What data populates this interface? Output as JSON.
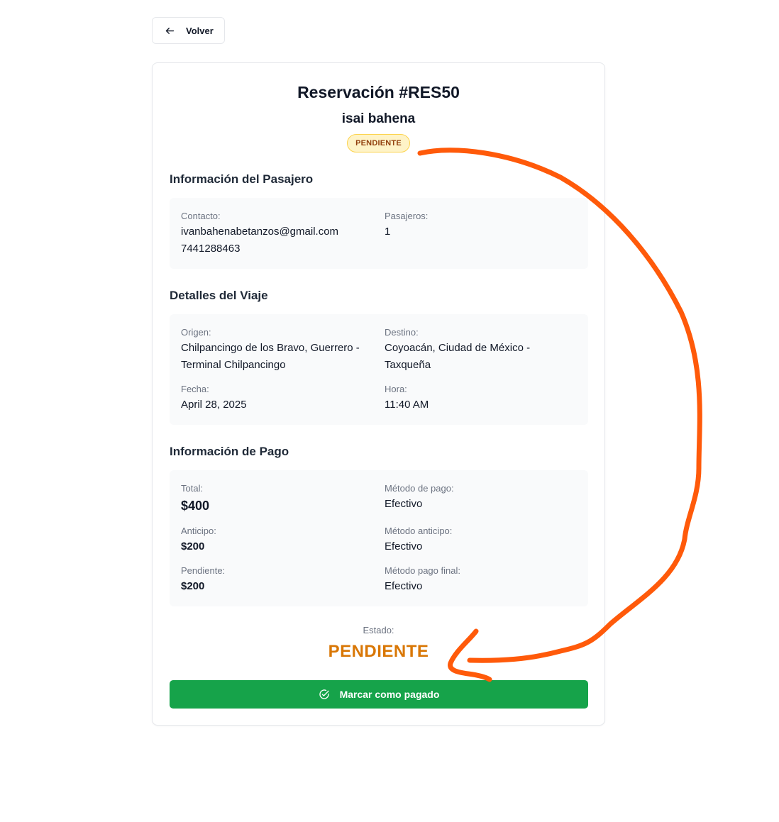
{
  "back_button": {
    "label": "Volver",
    "icon": "arrow-left-icon"
  },
  "reservation": {
    "title": "Reservación #RES50",
    "customer_name": "isai bahena",
    "status_badge": "PENDIENTE"
  },
  "passenger": {
    "section_title": "Información del Pasajero",
    "contact_label": "Contacto:",
    "email": "ivanbahenabetanzos@gmail.com",
    "phone": "7441288463",
    "passengers_label": "Pasajeros:",
    "passengers_value": "1"
  },
  "trip": {
    "section_title": "Detalles del Viaje",
    "origin_label": "Origen:",
    "origin_line1": "Chilpancingo de los Bravo, Guerrero -",
    "origin_line2": "Terminal Chilpancingo",
    "destination_label": "Destino:",
    "destination_line1": "Coyoacán, Ciudad de México -",
    "destination_line2": "Taxqueña",
    "date_label": "Fecha:",
    "date_value": "April 28, 2025",
    "time_label": "Hora:",
    "time_value": "11:40 AM"
  },
  "payment": {
    "section_title": "Información de Pago",
    "total_label": "Total:",
    "total_value": "$400",
    "method_label": "Método de pago:",
    "method_value": "Efectivo",
    "deposit_label": "Anticipo:",
    "deposit_value": "$200",
    "deposit_method_label": "Método anticipo:",
    "deposit_method_value": "Efectivo",
    "pending_label": "Pendiente:",
    "pending_value": "$200",
    "final_method_label": "Método pago final:",
    "final_method_value": "Efectivo"
  },
  "estado": {
    "label": "Estado:",
    "value": "PENDIENTE"
  },
  "mark_paid_button": {
    "label": "Marcar como pagado",
    "icon": "check-circle-icon"
  },
  "colors": {
    "accent_green": "#16a34a",
    "pending_orange": "#d97706",
    "badge_bg": "#fef3c7",
    "annotation_orange": "#ff5a0a"
  }
}
